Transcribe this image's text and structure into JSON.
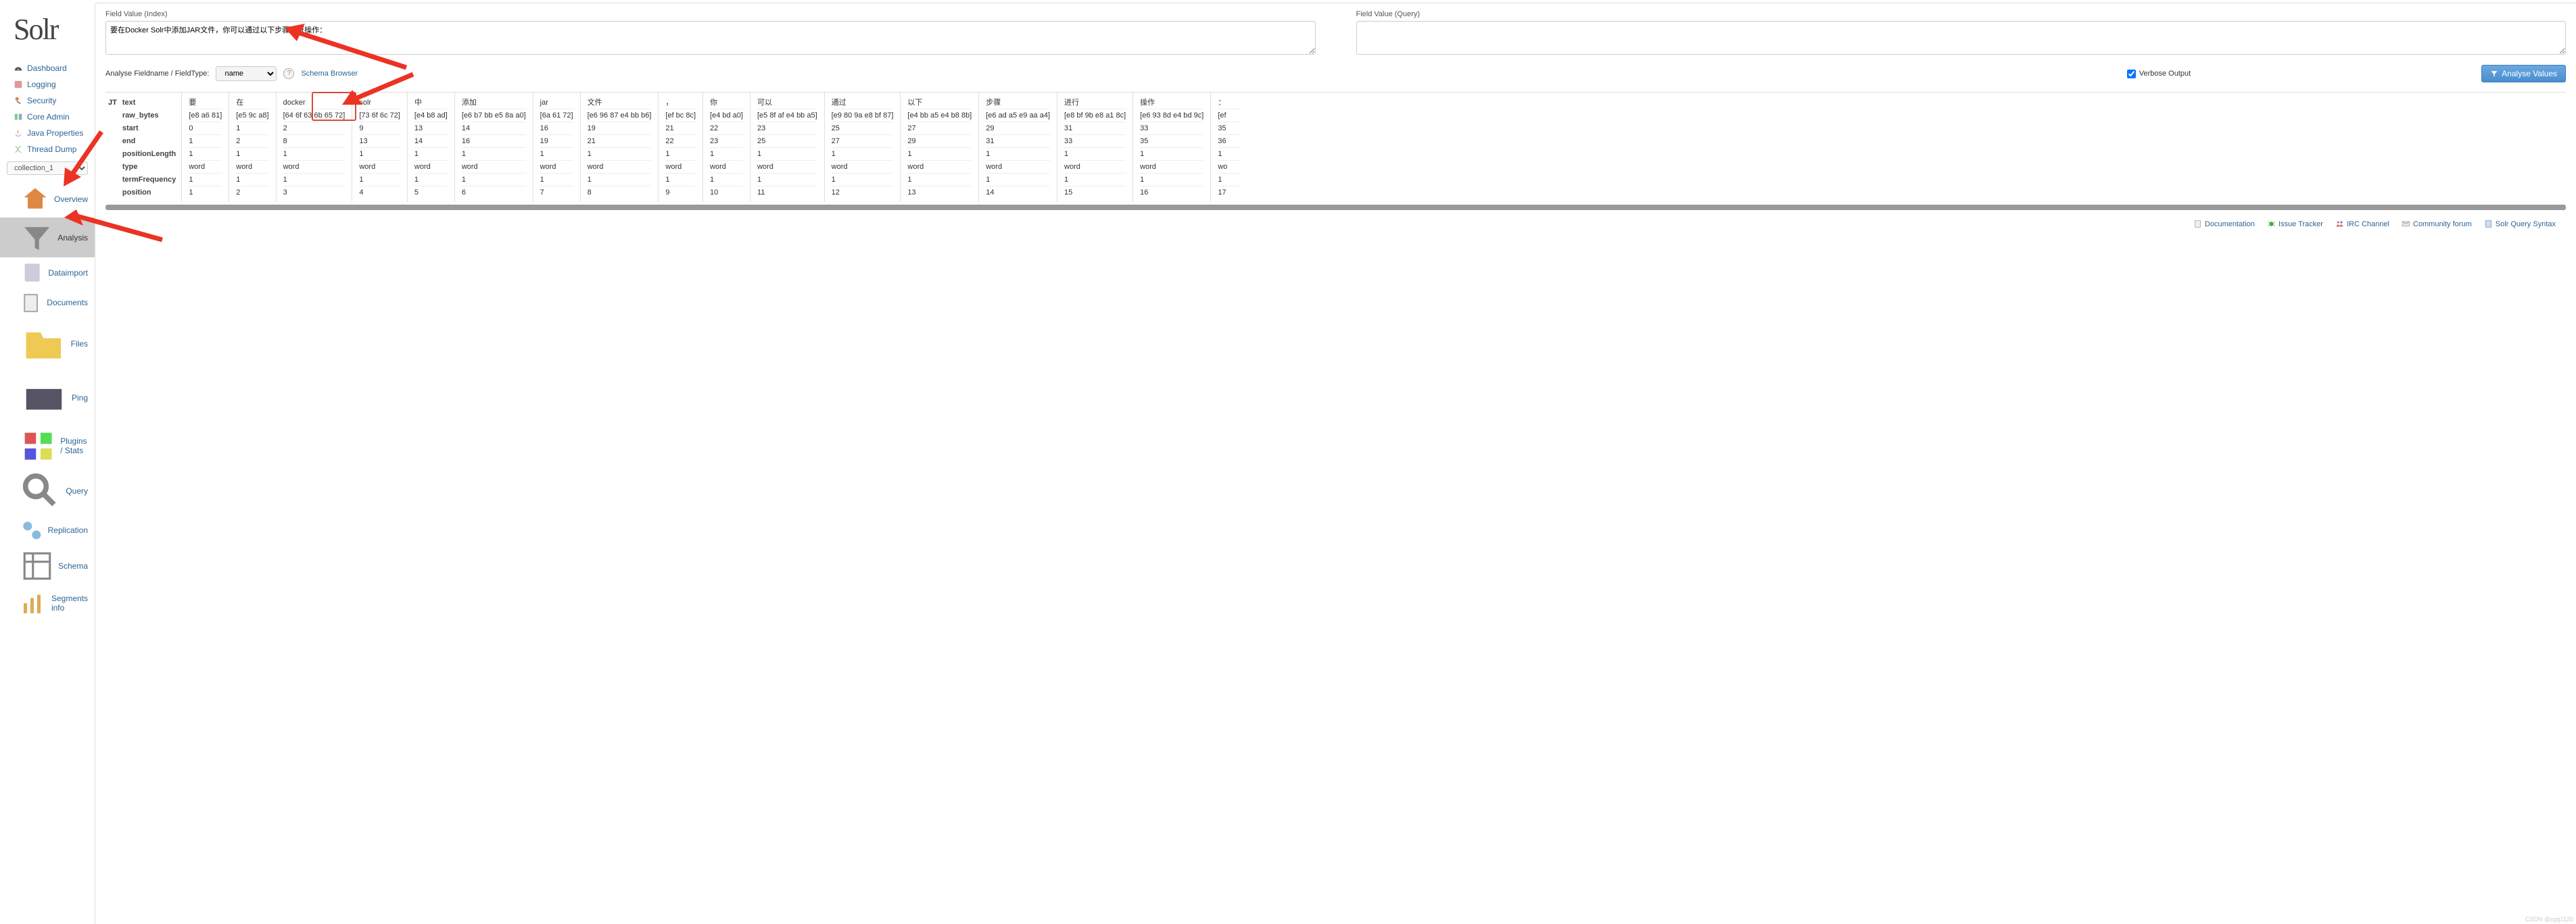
{
  "logo": "Solr",
  "nav": {
    "items": [
      {
        "label": "Dashboard"
      },
      {
        "label": "Logging"
      },
      {
        "label": "Security"
      },
      {
        "label": "Core Admin"
      },
      {
        "label": "Java Properties"
      },
      {
        "label": "Thread Dump"
      }
    ]
  },
  "collection_selector": "collection_1",
  "subnav": {
    "items": [
      {
        "label": "Overview"
      },
      {
        "label": "Analysis",
        "active": true
      },
      {
        "label": "Dataimport"
      },
      {
        "label": "Documents"
      },
      {
        "label": "Files"
      },
      {
        "label": "Ping"
      },
      {
        "label": "Plugins / Stats"
      },
      {
        "label": "Query"
      },
      {
        "label": "Replication"
      },
      {
        "label": "Schema"
      },
      {
        "label": "Segments info"
      }
    ]
  },
  "panel": {
    "index_label": "Field Value (Index)",
    "index_value": "要在Docker Solr中添加JAR文件，你可以通过以下步骤进行操作：",
    "query_label": "Field Value (Query)",
    "query_value": "",
    "analyse_label": "Analyse Fieldname / FieldType:",
    "fieldtype_value": "name",
    "schema_browser": "Schema Browser",
    "verbose_label": "Verbose Output",
    "analyse_button": "Analyse Values"
  },
  "analysis": {
    "abbr": "JT",
    "row_labels": [
      "text",
      "raw_bytes",
      "start",
      "end",
      "positionLength",
      "type",
      "termFrequency",
      "position"
    ],
    "columns": [
      {
        "text": "要",
        "raw": "[e8 a6 81]",
        "start": "0",
        "end": "1",
        "plen": "1",
        "type": "word",
        "tf": "1",
        "pos": "1"
      },
      {
        "text": "在",
        "raw": "[e5 9c a8]",
        "start": "1",
        "end": "2",
        "plen": "1",
        "type": "word",
        "tf": "1",
        "pos": "2"
      },
      {
        "text": "docker",
        "raw": "[64 6f 63 6b 65 72]",
        "start": "2",
        "end": "8",
        "plen": "1",
        "type": "word",
        "tf": "1",
        "pos": "3"
      },
      {
        "text": "solr",
        "raw": "[73 6f 6c 72]",
        "start": "9",
        "end": "13",
        "plen": "1",
        "type": "word",
        "tf": "1",
        "pos": "4"
      },
      {
        "text": "中",
        "raw": "[e4 b8 ad]",
        "start": "13",
        "end": "14",
        "plen": "1",
        "type": "word",
        "tf": "1",
        "pos": "5"
      },
      {
        "text": "添加",
        "raw": "[e6 b7 bb e5 8a a0]",
        "start": "14",
        "end": "16",
        "plen": "1",
        "type": "word",
        "tf": "1",
        "pos": "6"
      },
      {
        "text": "jar",
        "raw": "[6a 61 72]",
        "start": "16",
        "end": "19",
        "plen": "1",
        "type": "word",
        "tf": "1",
        "pos": "7"
      },
      {
        "text": "文件",
        "raw": "[e6 96 87 e4 bb b6]",
        "start": "19",
        "end": "21",
        "plen": "1",
        "type": "word",
        "tf": "1",
        "pos": "8"
      },
      {
        "text": "，",
        "raw": "[ef bc 8c]",
        "start": "21",
        "end": "22",
        "plen": "1",
        "type": "word",
        "tf": "1",
        "pos": "9"
      },
      {
        "text": "你",
        "raw": "[e4 bd a0]",
        "start": "22",
        "end": "23",
        "plen": "1",
        "type": "word",
        "tf": "1",
        "pos": "10"
      },
      {
        "text": "可以",
        "raw": "[e5 8f af e4 bb a5]",
        "start": "23",
        "end": "25",
        "plen": "1",
        "type": "word",
        "tf": "1",
        "pos": "11"
      },
      {
        "text": "通过",
        "raw": "[e9 80 9a e8 bf 87]",
        "start": "25",
        "end": "27",
        "plen": "1",
        "type": "word",
        "tf": "1",
        "pos": "12"
      },
      {
        "text": "以下",
        "raw": "[e4 bb a5 e4 b8 8b]",
        "start": "27",
        "end": "29",
        "plen": "1",
        "type": "word",
        "tf": "1",
        "pos": "13"
      },
      {
        "text": "步骤",
        "raw": "[e6 ad a5 e9 aa a4]",
        "start": "29",
        "end": "31",
        "plen": "1",
        "type": "word",
        "tf": "1",
        "pos": "14"
      },
      {
        "text": "进行",
        "raw": "[e8 bf 9b e8 a1 8c]",
        "start": "31",
        "end": "33",
        "plen": "1",
        "type": "word",
        "tf": "1",
        "pos": "15"
      },
      {
        "text": "操作",
        "raw": "[e6 93 8d e4 bd 9c]",
        "start": "33",
        "end": "35",
        "plen": "1",
        "type": "word",
        "tf": "1",
        "pos": "16"
      },
      {
        "text": "：",
        "raw": "[ef",
        "start": "35",
        "end": "36",
        "plen": "1",
        "type": "wo",
        "tf": "1",
        "pos": "17"
      }
    ]
  },
  "footer": {
    "items": [
      {
        "label": "Documentation"
      },
      {
        "label": "Issue Tracker"
      },
      {
        "label": "IRC Channel"
      },
      {
        "label": "Community forum"
      },
      {
        "label": "Solr Query Syntax"
      }
    ]
  },
  "watermark": "CSDN @xgg1120"
}
